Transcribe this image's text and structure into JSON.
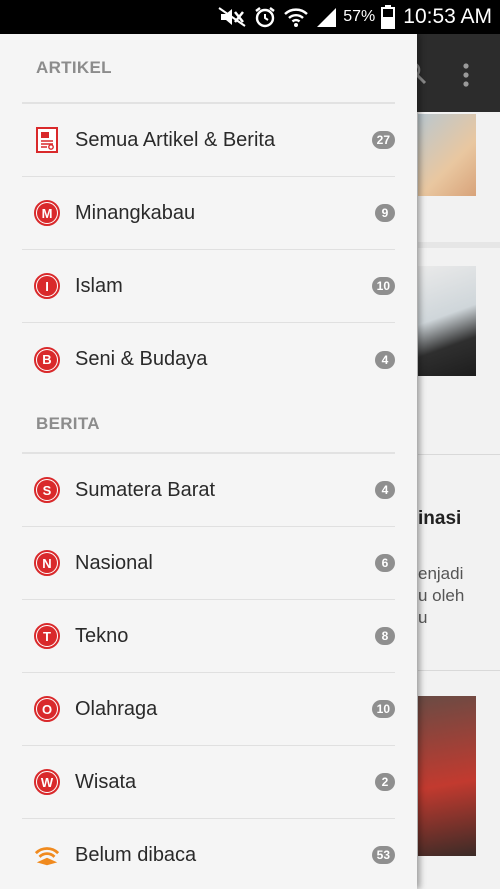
{
  "status_bar": {
    "battery_percent": "57%",
    "time": "10:53 AM",
    "icons": [
      "mute-icon",
      "alarm-icon",
      "wifi-icon",
      "signal-icon",
      "battery-icon"
    ]
  },
  "background": {
    "headline": "inasi",
    "snippet_lines": [
      "enjadi",
      "u oleh",
      "u"
    ]
  },
  "drawer": {
    "sections": [
      {
        "title": "ARTIKEL",
        "items": [
          {
            "label": "Semua Artikel & Berita",
            "count": "27",
            "icon": "document-icon"
          },
          {
            "label": "Minangkabau",
            "count": "9",
            "letter": "M"
          },
          {
            "label": "Islam",
            "count": "10",
            "letter": "I"
          },
          {
            "label": "Seni & Budaya",
            "count": "4",
            "letter": "B"
          }
        ]
      },
      {
        "title": "BERITA",
        "items": [
          {
            "label": "Sumatera Barat",
            "count": "4",
            "letter": "S"
          },
          {
            "label": "Nasional",
            "count": "6",
            "letter": "N"
          },
          {
            "label": "Tekno",
            "count": "8",
            "letter": "T"
          },
          {
            "label": "Olahraga",
            "count": "10",
            "letter": "O"
          },
          {
            "label": "Wisata",
            "count": "2",
            "letter": "W"
          },
          {
            "label": "Belum dibaca",
            "count": "53",
            "icon": "rss-icon"
          }
        ]
      }
    ]
  },
  "colors": {
    "accent_red": "#d9292b",
    "rss_orange": "#f08a1e",
    "badge_gray": "#8f8f8f"
  }
}
